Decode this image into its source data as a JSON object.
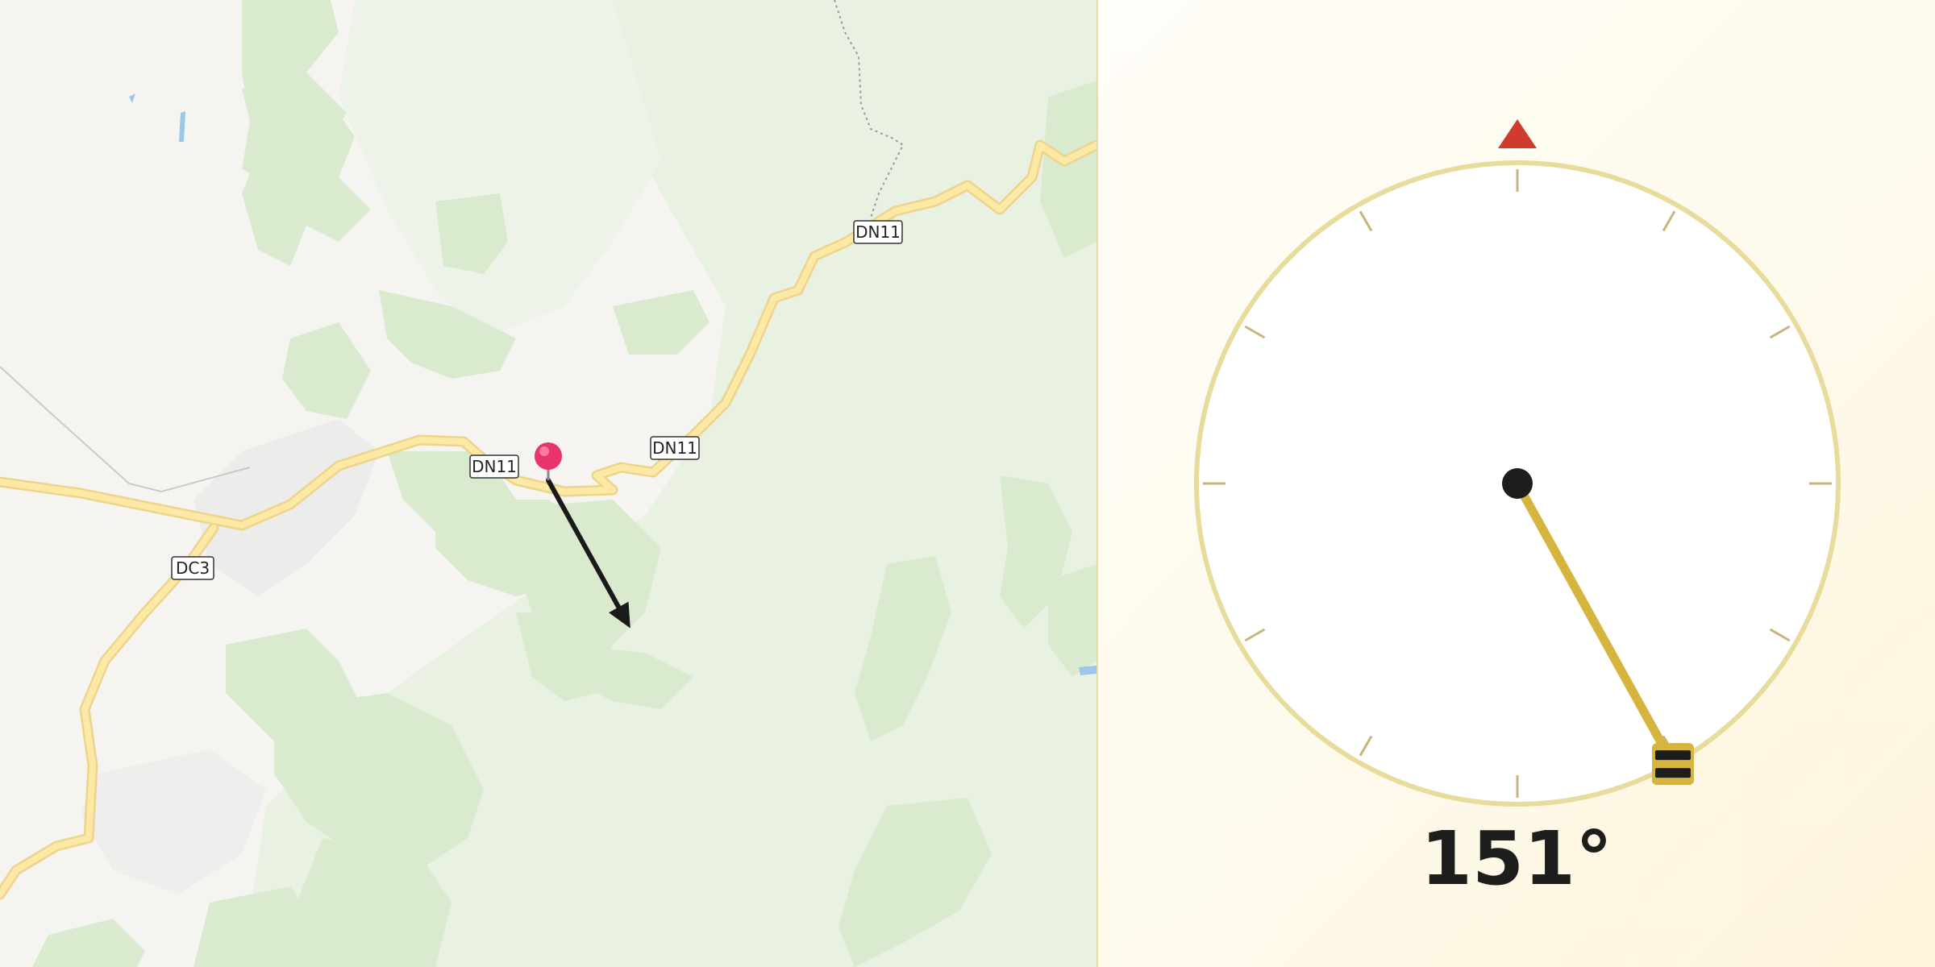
{
  "map": {
    "road_labels": [
      {
        "id": "dn11-east",
        "text": "DN11"
      },
      {
        "id": "dn11-center",
        "text": "DN11"
      },
      {
        "id": "dn11-west",
        "text": "DN11"
      },
      {
        "id": "dc3",
        "text": "DC3"
      }
    ],
    "marker": {
      "icon": "map-pin-icon",
      "color": "#e8336b"
    },
    "direction_arrow": {
      "icon": "direction-arrow-icon",
      "heading_degrees": 151
    }
  },
  "compass": {
    "heading_degrees": 151,
    "heading_text": "151°",
    "north_marker_icon": "north-triangle-icon",
    "north_marker_color": "#cf3b2d",
    "ring_color": "#e8dc9c",
    "needle_color": "#d6b53e",
    "needle_handle_icon": "needle-handle-icon",
    "tick_count": 12
  },
  "colors": {
    "road_casing": "#eed48a",
    "road_fill": "#fde9a6",
    "forest": "#ddecd3",
    "land": "#f6f4f1"
  }
}
